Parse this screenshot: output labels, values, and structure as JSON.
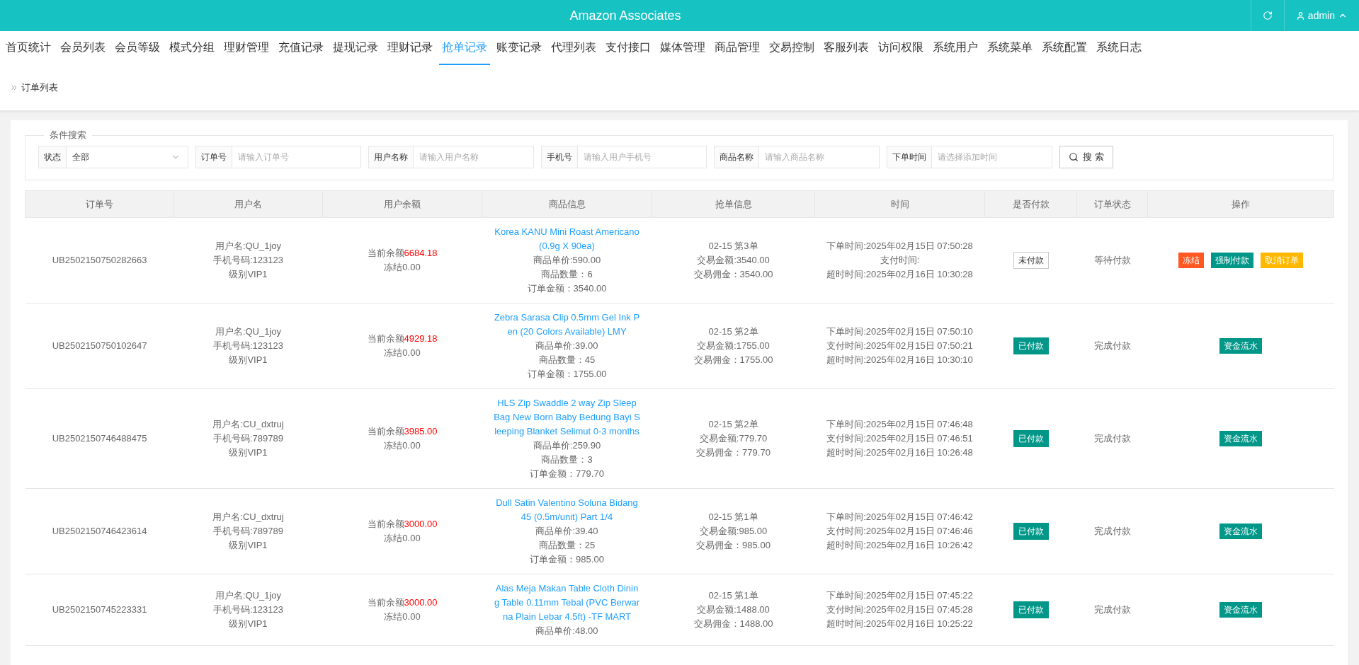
{
  "header": {
    "title": "Amazon Associates",
    "user": "admin"
  },
  "nav": [
    {
      "label": "首页统计",
      "selected": false
    },
    {
      "label": "会员列表",
      "selected": false
    },
    {
      "label": "会员等级",
      "selected": false
    },
    {
      "label": "模式分组",
      "selected": false
    },
    {
      "label": "理财管理",
      "selected": false
    },
    {
      "label": "充值记录",
      "selected": false
    },
    {
      "label": "提现记录",
      "selected": false
    },
    {
      "label": "理财记录",
      "selected": false
    },
    {
      "label": "抢单记录",
      "selected": true
    },
    {
      "label": "账变记录",
      "selected": false
    },
    {
      "label": "代理列表",
      "selected": false
    },
    {
      "label": "支付接口",
      "selected": false
    },
    {
      "label": "媒体管理",
      "selected": false
    },
    {
      "label": "商品管理",
      "selected": false
    },
    {
      "label": "交易控制",
      "selected": false
    },
    {
      "label": "客服列表",
      "selected": false
    },
    {
      "label": "访问权限",
      "selected": false
    },
    {
      "label": "系统用户",
      "selected": false
    },
    {
      "label": "系统菜单",
      "selected": false
    },
    {
      "label": "系统配置",
      "selected": false
    },
    {
      "label": "系统日志",
      "selected": false
    }
  ],
  "breadcrumb": "订单列表",
  "search": {
    "legend": "条件搜索",
    "status": {
      "label": "状态",
      "value": "全部"
    },
    "fields": [
      {
        "label": "订单号",
        "placeholder": "请输入订单号"
      },
      {
        "label": "用户名称",
        "placeholder": "请输入用户名称"
      },
      {
        "label": "手机号",
        "placeholder": "请输入用户手机号"
      },
      {
        "label": "商品名称",
        "placeholder": "请输入商品名称"
      },
      {
        "label": "下单时间",
        "placeholder": "请选择添加时间"
      }
    ],
    "button": "搜 索"
  },
  "table": {
    "columns": [
      "订单号",
      "用户名",
      "用户余额",
      "商品信息",
      "抢单信息",
      "时间",
      "是否付款",
      "订单状态",
      "操作"
    ],
    "rows": [
      {
        "order_no": "UB2502150750282663",
        "user": [
          "用户名:QU_1joy",
          "手机号码:123123",
          "级别VIP1"
        ],
        "balance_label": "当前余额",
        "balance": "6684.18",
        "frozen": "冻结0.00",
        "product": "Korea KANU Mini Roast Americano (0.9g X 90ea)",
        "product_lines": [
          "商品单价:590.00",
          "商品数量：6",
          "订单金额：3540.00"
        ],
        "grab": [
          "02-15 第3单",
          "交易金额:3540.00",
          "交易佣金：3540.00"
        ],
        "times": [
          "下单时间:2025年02月15日 07:50:28",
          "支付时间:",
          "超时时间:2025年02月16日 10:30:28"
        ],
        "paid": false,
        "pay_text": "未付款",
        "status": "等待付款",
        "actions": [
          {
            "label": "冻结",
            "kind": "freeze"
          },
          {
            "label": "强制付款",
            "kind": "force"
          },
          {
            "label": "取消订单",
            "kind": "cancel"
          }
        ]
      },
      {
        "order_no": "UB2502150750102647",
        "user": [
          "用户名:QU_1joy",
          "手机号码:123123",
          "级别VIP1"
        ],
        "balance_label": "当前余额",
        "balance": "4929.18",
        "frozen": "冻结0.00",
        "product": "Zebra Sarasa Clip 0.5mm Gel Ink Pen (20 Colors Available) LMY",
        "product_lines": [
          "商品单价:39.00",
          "商品数量：45",
          "订单金额：1755.00"
        ],
        "grab": [
          "02-15 第2单",
          "交易金额:1755.00",
          "交易佣金：1755.00"
        ],
        "times": [
          "下单时间:2025年02月15日 07:50:10",
          "支付时间:2025年02月15日 07:50:21",
          "超时时间:2025年02月16日 10:30:10"
        ],
        "paid": true,
        "pay_text": "已付款",
        "status": "完成付款",
        "actions": [
          {
            "label": "资金流水",
            "kind": "flow"
          }
        ]
      },
      {
        "order_no": "UB2502150746488475",
        "user": [
          "用户名:CU_dxtruj",
          "手机号码:789789",
          "级别VIP1"
        ],
        "balance_label": "当前余额",
        "balance": "3985.00",
        "frozen": "冻结0.00",
        "product": "HLS Zip Swaddle 2 way Zip Sleep Bag New Born Baby Bedung Bayi Sleeping Blanket Selimut 0-3 months",
        "product_lines": [
          "商品单价:259.90",
          "商品数量：3",
          "订单金额：779.70"
        ],
        "grab": [
          "02-15 第2单",
          "交易金额:779.70",
          "交易佣金：779.70"
        ],
        "times": [
          "下单时间:2025年02月15日 07:46:48",
          "支付时间:2025年02月15日 07:46:51",
          "超时时间:2025年02月16日 10:26:48"
        ],
        "paid": true,
        "pay_text": "已付款",
        "status": "完成付款",
        "actions": [
          {
            "label": "资金流水",
            "kind": "flow"
          }
        ]
      },
      {
        "order_no": "UB2502150746423614",
        "user": [
          "用户名:CU_dxtruj",
          "手机号码:789789",
          "级别VIP1"
        ],
        "balance_label": "当前余额",
        "balance": "3000.00",
        "frozen": "冻结0.00",
        "product": "Dull Satin Valentino Soluna Bidang 45 (0.5m/unit) Part 1/4",
        "product_lines": [
          "商品单价:39.40",
          "商品数量：25",
          "订单金额：985.00"
        ],
        "grab": [
          "02-15 第1单",
          "交易金额:985.00",
          "交易佣金：985.00"
        ],
        "times": [
          "下单时间:2025年02月15日 07:46:42",
          "支付时间:2025年02月15日 07:46:46",
          "超时时间:2025年02月16日 10:26:42"
        ],
        "paid": true,
        "pay_text": "已付款",
        "status": "完成付款",
        "actions": [
          {
            "label": "资金流水",
            "kind": "flow"
          }
        ]
      },
      {
        "order_no": "UB2502150745223331",
        "user": [
          "用户名:QU_1joy",
          "手机号码:123123",
          "级别VIP1"
        ],
        "balance_label": "当前余额",
        "balance": "3000.00",
        "frozen": "冻结0.00",
        "product": "Alas Meja Makan Table Cloth Dining Table 0.11mm Tebal (PVC Berwarna Plain Lebar 4.5ft) -TF MART",
        "product_lines": [
          "商品单价:48.00"
        ],
        "grab": [
          "02-15 第1单",
          "交易金额:1488.00",
          "交易佣金：1488.00"
        ],
        "times": [
          "下单时间:2025年02月15日 07:45:22",
          "支付时间:2025年02月15日 07:45:28",
          "超时时间:2025年02月16日 10:25:22"
        ],
        "paid": true,
        "pay_text": "已付款",
        "status": "完成付款",
        "actions": [
          {
            "label": "资金流水",
            "kind": "flow"
          }
        ]
      }
    ]
  }
}
